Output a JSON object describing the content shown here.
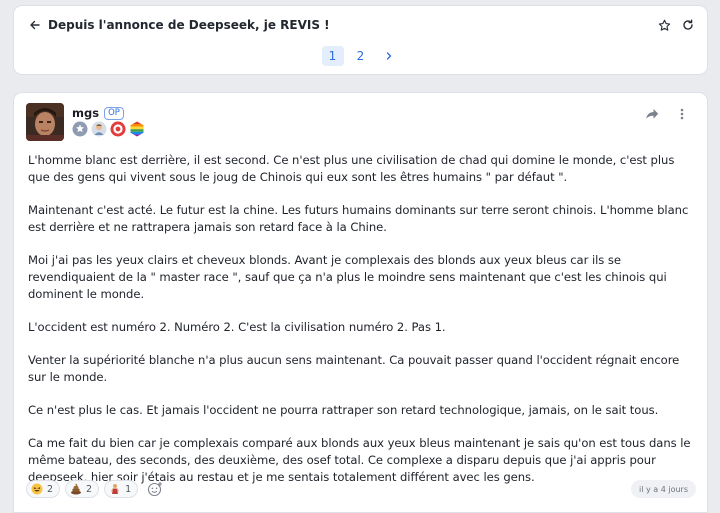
{
  "topic": {
    "title": "Depuis l'annonce de Deepseek, je REVIS !",
    "pages": [
      "1",
      "2"
    ],
    "current_page": "1"
  },
  "post": {
    "author": "mgs",
    "op_label": "OP",
    "badges": [
      "silver-star-badge",
      "character-badge",
      "red-circle-badge",
      "rainbow-badge"
    ],
    "paragraphs": [
      "L'homme blanc est derrière, il est second. Ce n'est plus une civilisation de chad qui domine le monde, c'est plus que des gens qui vivent sous le joug de Chinois qui eux sont les êtres humains \" par défaut \".",
      "Maintenant c'est acté. Le futur est la chine. Les futurs humains dominants sur terre seront chinois. L'homme blanc est derrière et ne rattrapera jamais son retard face à la Chine.",
      "Moi j'ai pas les yeux clairs et cheveux blonds. Avant je complexais des blonds aux yeux bleus car ils se revendiquaient de la \" master race \", sauf que ça n'a plus le moindre sens maintenant que c'est les chinois qui dominent le monde.",
      "L'occident est numéro 2. Numéro 2. C'est la civilisation numéro 2. Pas 1.",
      "Venter la supériorité blanche n'a plus aucun sens maintenant. Ca pouvait passer quand l'occident régnait encore sur le monde.",
      "Ce n'est plus le cas. Et jamais l'occident ne pourra rattraper son retard technologique, jamais, on le sait tous.",
      "Ca me fait du bien car je complexais comparé aux blonds aux yeux bleus maintenant je sais qu'on est tous dans le même bateau, des seconds, des deuxième, des osef total. Ce complexe a disparu depuis que j'ai appris pour deepseek, hier soir j'étais au restau et je me sentais totalement différent avec les gens."
    ],
    "reactions": [
      {
        "icon": "laughing-face-icon",
        "count": "2"
      },
      {
        "icon": "poop-icon",
        "count": "2"
      },
      {
        "icon": "person-emoji-icon",
        "count": "1"
      }
    ],
    "timestamp": "il y a 4 jours"
  },
  "colors": {
    "accent": "#2f6fdb",
    "background": "#e9ebef"
  }
}
